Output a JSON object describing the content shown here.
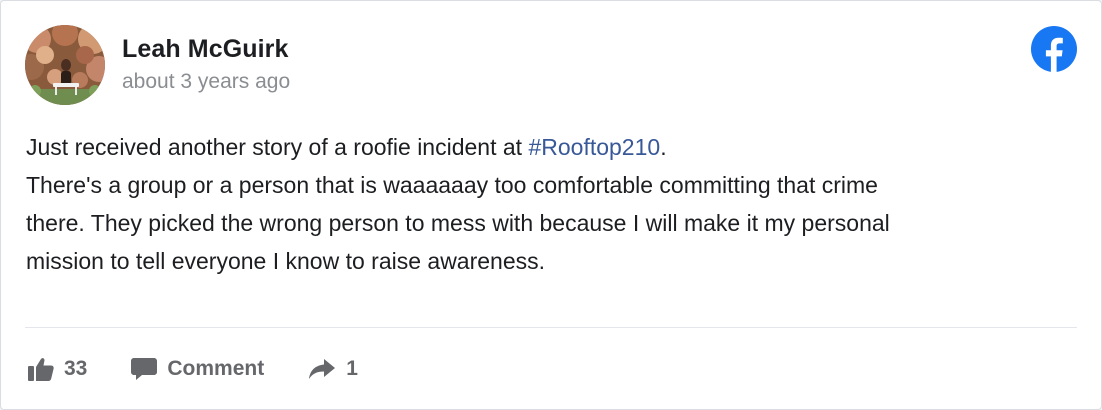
{
  "post": {
    "author": "Leah McGuirk",
    "time": "about 3 years ago",
    "body_line1_before": "Just received another story of a roofie incident at ",
    "hashtag": "#Rooftop210",
    "body_line1_after": ".",
    "body_line2": "There's a group or a person that is waaaaaay too comfortable committing that crime",
    "body_line3": "there. They picked the wrong person to mess with because I will make it my personal",
    "body_line4": "mission to tell everyone I know to raise awareness."
  },
  "actions": {
    "like_count": "33",
    "comment_label": "Comment",
    "share_count": "1"
  },
  "icons": {
    "brand": "facebook-logo-icon",
    "like": "thumbs-up-icon",
    "comment": "comment-bubble-icon",
    "share": "share-arrow-icon"
  },
  "colors": {
    "facebook_blue": "#1877f2",
    "hashtag": "#385898",
    "muted": "#65676b",
    "timestamp": "#8a8d91"
  }
}
